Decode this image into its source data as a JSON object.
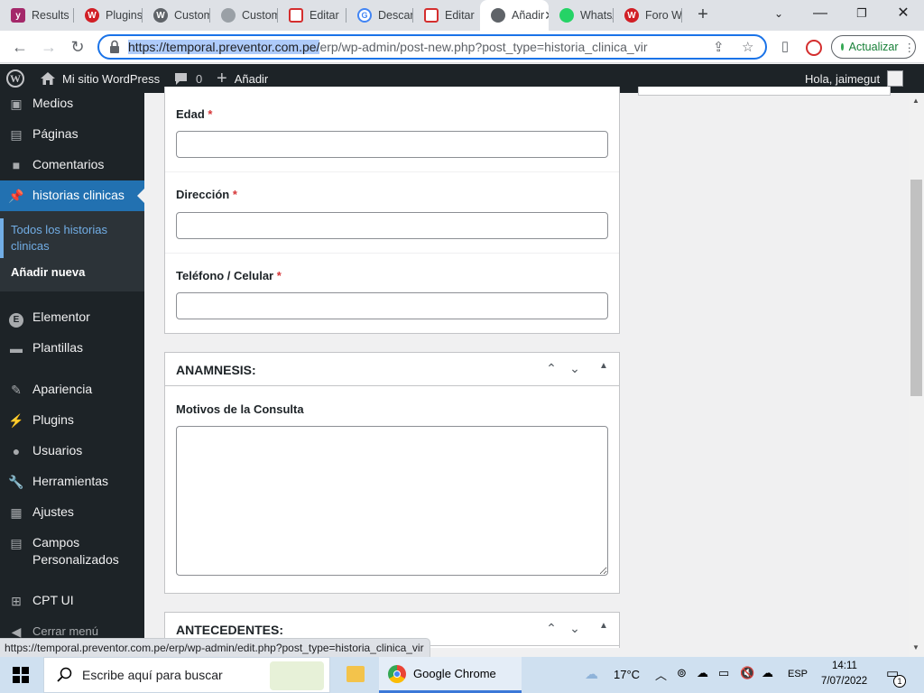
{
  "browser": {
    "tabs": [
      {
        "label": "Results",
        "icon": "yoast-icon",
        "color": "#a4286a"
      },
      {
        "label": "Plugins",
        "icon": "wordfence-icon",
        "color": "#d11f26"
      },
      {
        "label": "Custom",
        "icon": "wordpress-icon",
        "color": "#5f6368"
      },
      {
        "label": "Custom",
        "icon": "globe-icon",
        "color": "#9aa0a6"
      },
      {
        "label": "Editar",
        "icon": "acf-icon",
        "color": "#d42e2e"
      },
      {
        "label": "Descargar",
        "icon": "google-icon",
        "color": "#4285f4"
      },
      {
        "label": "Editar",
        "icon": "acf-icon",
        "color": "#d42e2e"
      },
      {
        "label": "Añadir",
        "icon": "globe-icon",
        "color": "#5f6368",
        "active": true
      },
      {
        "label": "WhatsApp",
        "icon": "whatsapp-icon",
        "color": "#25d366"
      },
      {
        "label": "Foro W",
        "icon": "wordfence-icon",
        "color": "#d11f26"
      }
    ],
    "url_highlight": "https://temporal.preventor.com.pe/",
    "url_rest": "erp/wp-admin/post-new.php?post_type=historia_clinica_vir",
    "update_label": "Actualizar"
  },
  "adminbar": {
    "site_name": "Mi sitio WordPress",
    "comments_count": "0",
    "new_label": "Añadir",
    "greeting": "Hola, jaimegut"
  },
  "sidebar": {
    "items": [
      {
        "label": "Medios",
        "icon": "media-icon"
      },
      {
        "label": "Páginas",
        "icon": "pages-icon"
      },
      {
        "label": "Comentarios",
        "icon": "comments-icon"
      },
      {
        "label": "historias clinicas",
        "icon": "pin-icon",
        "current": true
      },
      {
        "label": "Elementor",
        "icon": "elementor-icon"
      },
      {
        "label": "Plantillas",
        "icon": "folder-icon"
      },
      {
        "label": "Apariencia",
        "icon": "brush-icon"
      },
      {
        "label": "Plugins",
        "icon": "plugin-icon"
      },
      {
        "label": "Usuarios",
        "icon": "user-icon"
      },
      {
        "label": "Herramientas",
        "icon": "wrench-icon"
      },
      {
        "label": "Ajustes",
        "icon": "settings-icon"
      },
      {
        "label": "Campos Personalizados",
        "icon": "fields-icon"
      },
      {
        "label": "CPT UI",
        "icon": "cptui-icon"
      },
      {
        "label": "Cerrar menú",
        "icon": "collapse-icon"
      }
    ],
    "submenu": [
      {
        "label": "Todos los historias clinicas"
      },
      {
        "label": "Añadir nueva"
      }
    ]
  },
  "form": {
    "fields": [
      {
        "label": "Edad",
        "required": "*",
        "value": ""
      },
      {
        "label": "Dirección",
        "required": "*",
        "value": ""
      },
      {
        "label": "Teléfono / Celular",
        "required": "*",
        "value": ""
      }
    ],
    "anamnesis": {
      "title": "ANAMNESIS:",
      "field_label": "Motivos de la Consulta",
      "value": ""
    },
    "antecedentes": {
      "title": "ANTECEDENTES:"
    }
  },
  "statusbar": {
    "url": "https://temporal.preventor.com.pe/erp/wp-admin/edit.php?post_type=historia_clinica_vir"
  },
  "taskbar": {
    "search_placeholder": "Escribe aquí para buscar",
    "app_label": "Google Chrome",
    "weather": "17°C",
    "language": "ESP",
    "time": "14:11",
    "date": "7/07/2022",
    "notifications": "1"
  },
  "colors": {
    "wp_dark": "#1d2327",
    "wp_blue": "#2271b1",
    "required": "#d63638",
    "chrome_blue": "#1a73e8"
  }
}
